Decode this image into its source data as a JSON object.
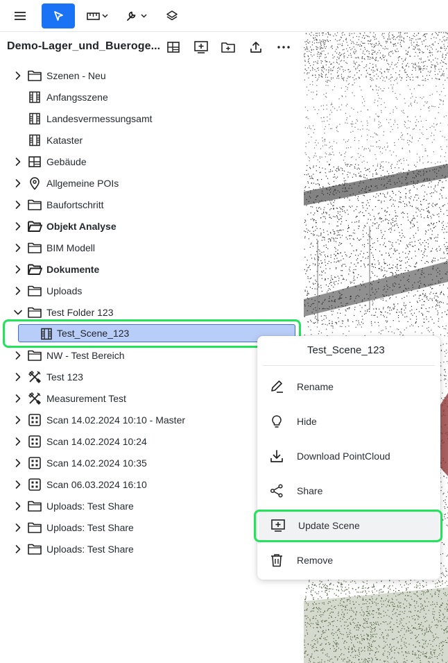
{
  "toolbar": {
    "menu_icon": "hamburger-menu-icon",
    "select_icon": "pointer-arrow-icon",
    "measure_icon": "ruler-icon",
    "tools_icon": "wrench-icon",
    "layers_icon": "layers-icon",
    "accent": "#1a73f5"
  },
  "header": {
    "title": "Demo-Lager_und_Bueroge...",
    "icons": [
      "grid-layout-icon",
      "add-scene-icon",
      "new-folder-icon",
      "upload-icon",
      "more-icon"
    ]
  },
  "tree": {
    "items": [
      {
        "label": "Szenen - Neu",
        "icon": "folder-icon",
        "chevron": "right",
        "bold": false
      },
      {
        "label": "Anfangsszene",
        "icon": "film-icon",
        "chevron": "",
        "bold": false
      },
      {
        "label": "Landesvermessungsamt",
        "icon": "film-icon",
        "chevron": "",
        "bold": false
      },
      {
        "label": "Kataster",
        "icon": "film-icon",
        "chevron": "",
        "bold": false
      },
      {
        "label": "Gebäude",
        "icon": "building-plan-icon",
        "chevron": "right",
        "bold": false
      },
      {
        "label": "Allgemeine POIs",
        "icon": "location-pin-icon",
        "chevron": "right",
        "bold": false
      },
      {
        "label": "Baufortschritt",
        "icon": "folder-icon",
        "chevron": "right",
        "bold": false
      },
      {
        "label": "Objekt Analyse",
        "icon": "folder-open-icon",
        "chevron": "right",
        "bold": true
      },
      {
        "label": "BIM Modell",
        "icon": "folder-icon",
        "chevron": "right",
        "bold": false
      },
      {
        "label": "Dokumente",
        "icon": "folder-open-icon",
        "chevron": "right",
        "bold": true
      },
      {
        "label": "Uploads",
        "icon": "folder-icon",
        "chevron": "right",
        "bold": false
      },
      {
        "label": "Test Folder 123",
        "icon": "folder-icon",
        "chevron": "down",
        "bold": false
      },
      {
        "label": "Test_Scene_123",
        "icon": "film-icon",
        "chevron": "",
        "bold": false,
        "selected": true
      },
      {
        "label": "NW - Test Bereich",
        "icon": "folder-icon",
        "chevron": "right",
        "bold": false
      },
      {
        "label": "Test 123",
        "icon": "measure-tools-icon",
        "chevron": "right",
        "bold": false
      },
      {
        "label": "Measurement Test",
        "icon": "measure-tools-icon",
        "chevron": "right",
        "bold": false
      },
      {
        "label": "Scan 14.02.2024 10:10 - Master",
        "icon": "scan-grid-icon",
        "chevron": "right",
        "bold": false
      },
      {
        "label": "Scan 14.02.2024 10:24",
        "icon": "scan-grid-icon",
        "chevron": "right",
        "bold": false
      },
      {
        "label": "Scan 14.02.2024 10:35",
        "icon": "scan-grid-icon",
        "chevron": "right",
        "bold": false
      },
      {
        "label": "Scan 06.03.2024 16:10",
        "icon": "scan-grid-icon",
        "chevron": "right",
        "bold": false
      },
      {
        "label": "Uploads: Test Share",
        "icon": "folder-icon",
        "chevron": "right",
        "bold": false
      },
      {
        "label": "Uploads: Test Share",
        "icon": "folder-icon",
        "chevron": "right",
        "bold": false
      },
      {
        "label": "Uploads: Test Share",
        "icon": "folder-icon",
        "chevron": "right",
        "bold": false
      }
    ]
  },
  "context_menu": {
    "title": "Test_Scene_123",
    "items": [
      {
        "label": "Rename",
        "icon": "pen-icon"
      },
      {
        "label": "Hide",
        "icon": "lightbulb-icon"
      },
      {
        "label": "Download PointCloud",
        "icon": "download-icon"
      },
      {
        "label": "Share",
        "icon": "share-icon"
      },
      {
        "label": "Update Scene",
        "icon": "update-scene-icon",
        "highlighted": true
      },
      {
        "label": "Remove",
        "icon": "trash-icon"
      }
    ]
  },
  "colors": {
    "selection_bg": "#b8cdf7",
    "selection_border": "#3b6fd9",
    "highlight_outline": "#22e35a"
  }
}
